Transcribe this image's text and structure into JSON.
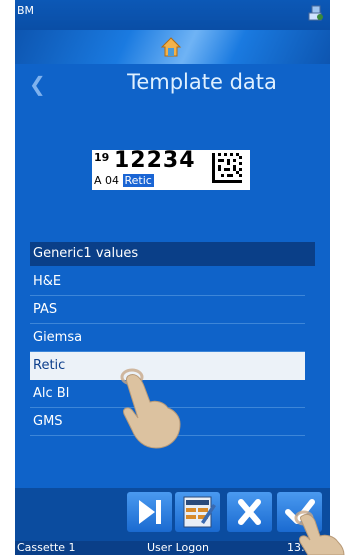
{
  "statusbar": {
    "app": "BM"
  },
  "page": {
    "title": "Template data"
  },
  "label": {
    "num_small": "19",
    "num_big": "12234",
    "line2_prefix": "A  04 ",
    "line2_selected": "Retic"
  },
  "list": {
    "header": "Generic1 values",
    "items": [
      "H&E",
      "PAS",
      "Giemsa",
      "Retic",
      "Alc Bl",
      "GMS"
    ],
    "selected_index": 3
  },
  "footer": {
    "left": "Cassette 1",
    "center": "User Logon",
    "time": "13:49"
  },
  "icons": {
    "back": "chevron-left-icon",
    "home": "home-icon",
    "network": "network-icon",
    "skip": "skip-forward-icon",
    "edit": "edit-template-icon",
    "cancel": "close-icon",
    "confirm": "checkmark-icon"
  },
  "colors": {
    "background": "#0f63c9",
    "header": "#0a3f88",
    "selected_row": "#ecf2f8",
    "title": "#dff0ff"
  }
}
